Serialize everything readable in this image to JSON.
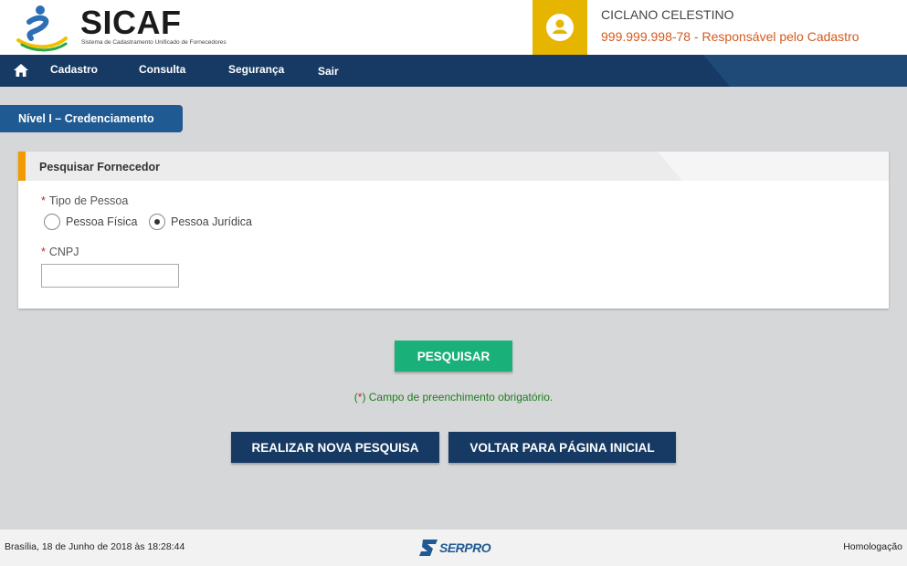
{
  "header": {
    "brand_title": "SICAF",
    "brand_subtitle": "Sistema de Cadastramento Unificado de Fornecedores",
    "user_name": "CICLANO CELESTINO",
    "user_role": "999.999.998-78 - Responsável pelo Cadastro"
  },
  "nav": {
    "items": [
      {
        "label": "Cadastro"
      },
      {
        "label": "Consulta"
      },
      {
        "label": "Segurança"
      },
      {
        "label": "Sair"
      }
    ]
  },
  "section_tab": "Nível I – Credenciamento",
  "panel": {
    "title": "Pesquisar Fornecedor",
    "tipo_label": "Tipo de Pessoa",
    "required_mark": "*",
    "options": [
      "Pessoa Física",
      "Pessoa Jurídica"
    ],
    "selected_option": "Pessoa Jurídica",
    "cnpj_label": "CNPJ",
    "cnpj_value": ""
  },
  "actions": {
    "search_label": "PESQUISAR",
    "required_note_open": "(",
    "required_note_star": "*",
    "required_note_text": ") Campo de preenchimento obrigatório.",
    "new_search_label": "REALIZAR NOVA PESQUISA",
    "home_label": "VOLTAR PARA PÁGINA INICIAL"
  },
  "footer": {
    "date": "Brasília, 18 de Junho de 2018 às 18:28:44",
    "logo_text": "SERPRO",
    "environment": "Homologação"
  },
  "colors": {
    "navbar": "#173a64",
    "user_box": "#e6b500",
    "search_button": "#1ab07a",
    "panel_accent": "#f29a00"
  }
}
